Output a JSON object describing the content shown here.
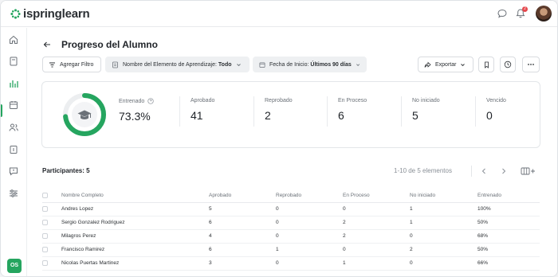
{
  "app": {
    "logo_text": "ispringlearn",
    "user_initials": "OS",
    "notification_count": "2"
  },
  "page": {
    "title": "Progreso del Alumno"
  },
  "filters": {
    "add_filter_label": "Agregar Filtro",
    "element_label": "Nombre del Elemento de Aprendizaje:",
    "element_value": "Todo",
    "date_label": "Fecha de Inicio:",
    "date_value": "Últimos 90 días",
    "export_label": "Exportar"
  },
  "stats": {
    "trained": {
      "label": "Entrenado",
      "value": "73.3%",
      "fraction": 0.733
    },
    "approved": {
      "label": "Aprobado",
      "value": "41"
    },
    "failed": {
      "label": "Reprobado",
      "value": "2"
    },
    "in_progress": {
      "label": "En Proceso",
      "value": "6"
    },
    "not_started": {
      "label": "No iniciado",
      "value": "5"
    },
    "expired": {
      "label": "Vencido",
      "value": "0"
    }
  },
  "participants": {
    "title": "Participantes: 5",
    "pagination": "1-10 de 5 elementos"
  },
  "table": {
    "headers": [
      "Nombre Completo",
      "Aprobado",
      "Reprobado",
      "En Proceso",
      "No iniciado",
      "Entrenado"
    ],
    "rows": [
      [
        "Andres Lopez",
        "5",
        "0",
        "0",
        "1",
        "100%"
      ],
      [
        "Sergio Gonzalez Rodriguez",
        "6",
        "0",
        "2",
        "1",
        "50%"
      ],
      [
        "Milagros Perez",
        "4",
        "0",
        "2",
        "0",
        "68%"
      ],
      [
        "Francisco Ramirez",
        "6",
        "1",
        "0",
        "2",
        "50%"
      ],
      [
        "Nicolas Puertas Martinez",
        "3",
        "0",
        "1",
        "0",
        "66%"
      ]
    ]
  },
  "colors": {
    "accent": "#25a55f",
    "badge": "#e5484d"
  }
}
